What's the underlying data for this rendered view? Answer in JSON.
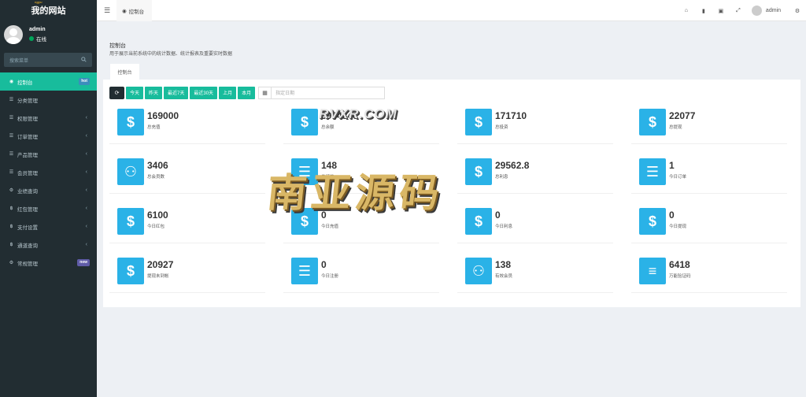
{
  "brand": {
    "mark": "ngyu",
    "title": "我的网站"
  },
  "user": {
    "name": "admin",
    "status": "在线"
  },
  "search": {
    "placeholder": "搜索菜单"
  },
  "menu": [
    {
      "label": "控制台",
      "icon": "dashboard-icon",
      "badge": "hot",
      "active": true
    },
    {
      "label": "分类管理",
      "icon": "list-icon"
    },
    {
      "label": "权限管理",
      "icon": "group-icon",
      "chevron": true
    },
    {
      "label": "订单管理",
      "icon": "list-icon",
      "chevron": true
    },
    {
      "label": "产品管理",
      "icon": "list-icon",
      "chevron": true
    },
    {
      "label": "会员管理",
      "icon": "list-icon",
      "chevron": true
    },
    {
      "label": "业绩查询",
      "icon": "gear-icon",
      "chevron": true
    },
    {
      "label": "红包管理",
      "icon": "bitcoin-icon",
      "chevron": true
    },
    {
      "label": "支付设置",
      "icon": "bitcoin-icon",
      "chevron": true
    },
    {
      "label": "通道查询",
      "icon": "bitcoin-icon",
      "chevron": true
    },
    {
      "label": "常规管理",
      "icon": "gear-icon",
      "badge": "new"
    }
  ],
  "topbar": {
    "tab": "控制台",
    "username": "admin"
  },
  "page": {
    "title": "控制台",
    "subtitle": "用于展示当前系统中的统计数据、统计报表及重要实时数据",
    "tab": "控制台"
  },
  "toolbar": {
    "buttons": [
      "今天",
      "昨天",
      "最近7天",
      "最近30天",
      "上月",
      "本月"
    ],
    "date_placeholder": "指定日期"
  },
  "stats": [
    {
      "value": "169000",
      "label": "总充值",
      "icon": "dollar-icon"
    },
    {
      "value": "3964346",
      "label": "总余额",
      "icon": "dollar-icon"
    },
    {
      "value": "171710",
      "label": "总投资",
      "icon": "dollar-icon"
    },
    {
      "value": "22077",
      "label": "总提现",
      "icon": "dollar-icon"
    },
    {
      "value": "3406",
      "label": "总会员数",
      "icon": "users-icon"
    },
    {
      "value": "148",
      "label": "总订单",
      "icon": "list-icon"
    },
    {
      "value": "29562.8",
      "label": "总利息",
      "icon": "dollar-icon"
    },
    {
      "value": "1",
      "label": "今日订单",
      "icon": "list-icon"
    },
    {
      "value": "6100",
      "label": "今日红包",
      "icon": "dollar-icon"
    },
    {
      "value": "0",
      "label": "今日充值",
      "icon": "dollar-icon"
    },
    {
      "value": "0",
      "label": "今日利息",
      "icon": "dollar-icon"
    },
    {
      "value": "0",
      "label": "今日提现",
      "icon": "dollar-icon"
    },
    {
      "value": "20927",
      "label": "提现未到帐",
      "icon": "dollar-icon"
    },
    {
      "value": "0",
      "label": "今日注册",
      "icon": "list-icon"
    },
    {
      "value": "138",
      "label": "有效会员",
      "icon": "users-icon"
    },
    {
      "value": "6418",
      "label": "万能验证码",
      "icon": "book-icon"
    }
  ],
  "watermark": {
    "sub": "RVXR.COM",
    "main": "南亚源码"
  },
  "colors": {
    "accent": "#18bc9c",
    "sidebar": "#222d32",
    "stat_icon": "#2ab2e7"
  }
}
